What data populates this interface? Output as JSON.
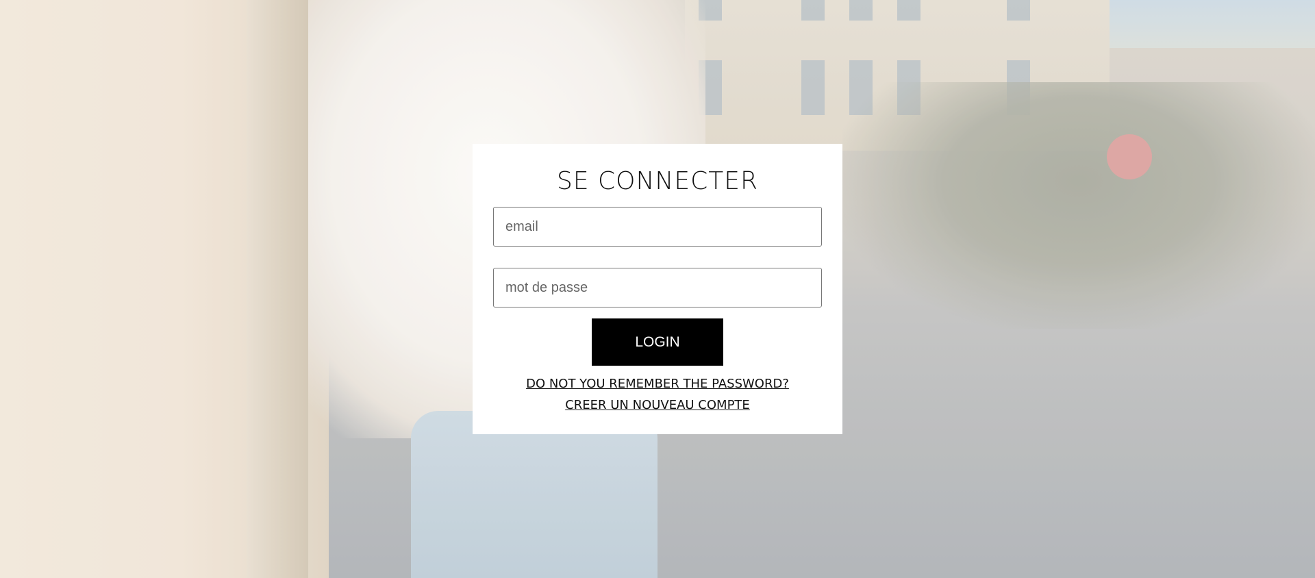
{
  "login_card": {
    "title": "SE CONNECTER",
    "email_placeholder": "email",
    "password_placeholder": "mot de passe",
    "login_label": "LOGIN",
    "forgot_password_label": "DO NOT YOU REMEMBER THE PASSWORD?",
    "create_account_label": "CREER UN NOUVEAU COMPTE"
  },
  "colors": {
    "card_background": "#ffffff",
    "button_background": "#000000",
    "button_text": "#ffffff"
  }
}
